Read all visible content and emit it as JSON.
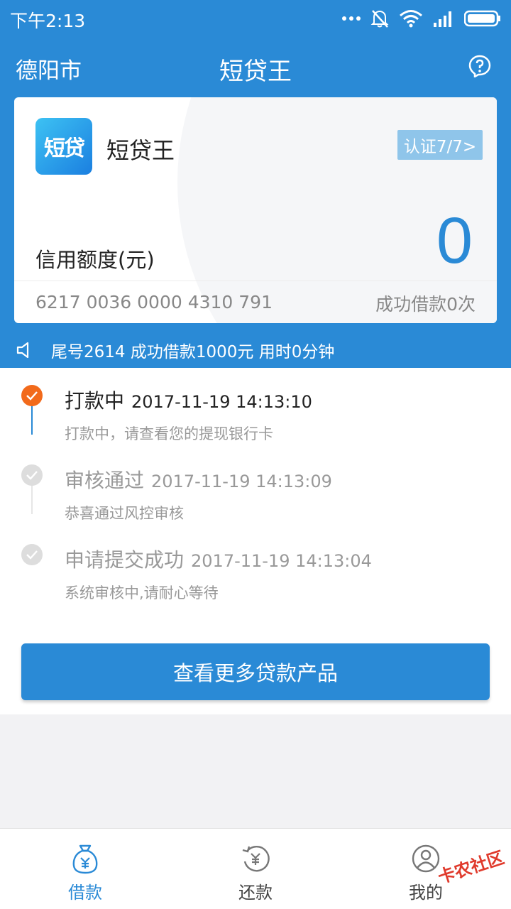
{
  "status_bar": {
    "time": "下午2:13"
  },
  "nav": {
    "city": "德阳市",
    "title": "短贷王",
    "help_icon": "help-bubble-icon"
  },
  "card": {
    "logo_text": "短贷",
    "app_name": "短贷王",
    "cert_badge": "认证7/7>",
    "credit_label": "信用额度(元)",
    "credit_value": "0",
    "card_number": "6217 0036 0000 4310 791",
    "loan_count": "成功借款0次"
  },
  "notice": {
    "icon": "speaker-icon",
    "text": "尾号2614 成功借款1000元 用时0分钟"
  },
  "timeline": [
    {
      "title": "打款中",
      "time": "2017-11-19 14:13:10",
      "desc": "打款中，请查看您的提现银行卡",
      "active": true
    },
    {
      "title": "审核通过",
      "time": "2017-11-19 14:13:09",
      "desc": "恭喜通过风控审核",
      "active": false
    },
    {
      "title": "申请提交成功",
      "time": "2017-11-19 14:13:04",
      "desc": "系统审核中,请耐心等待",
      "active": false
    }
  ],
  "more_button": "查看更多贷款产品",
  "tabs": [
    {
      "label": "借款",
      "icon": "money-bag-icon",
      "active": true
    },
    {
      "label": "还款",
      "icon": "repay-icon",
      "active": false
    },
    {
      "label": "我的",
      "icon": "user-icon",
      "active": false
    }
  ],
  "watermark": "卡农社区",
  "colors": {
    "primary": "#2a8ad6",
    "active_dot": "#f26a1b",
    "inactive": "#999999"
  }
}
